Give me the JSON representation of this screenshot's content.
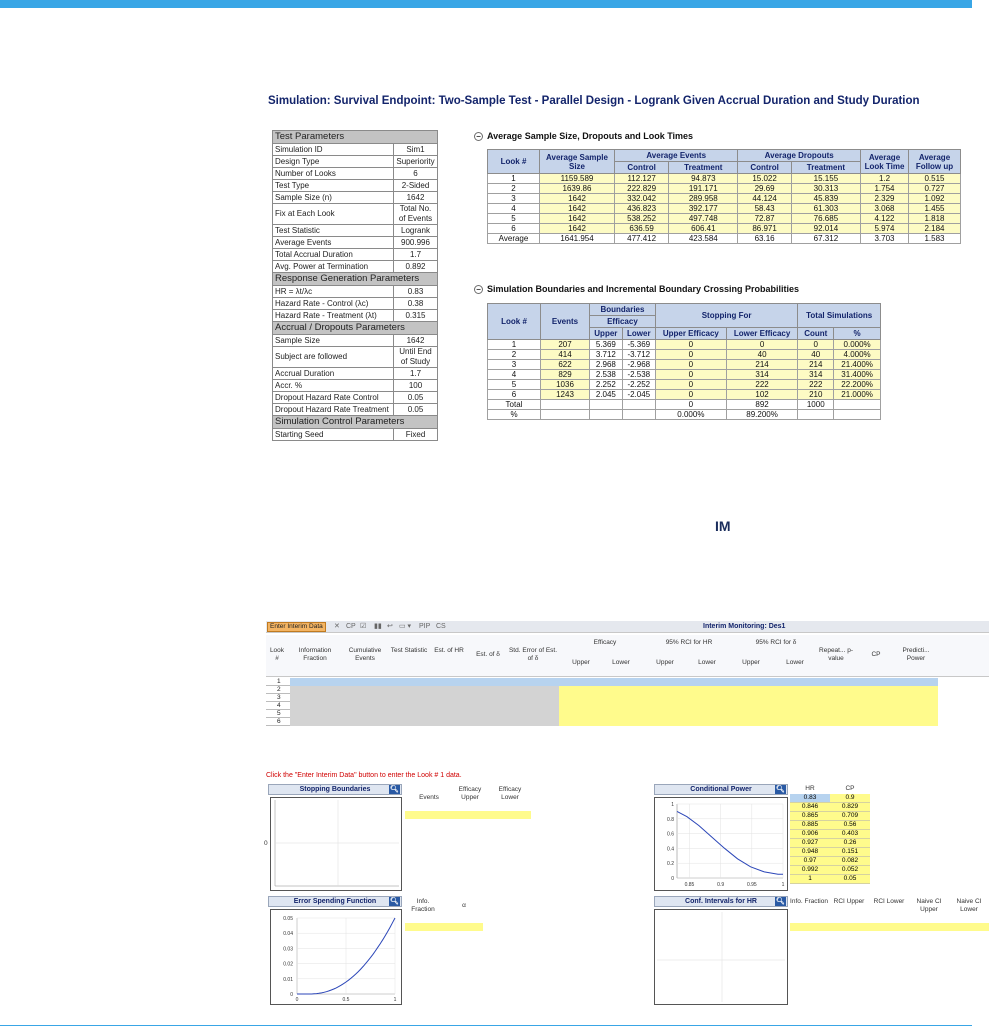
{
  "page_title": "Simulation: Survival Endpoint: Two-Sample Test - Parallel Design - Logrank Given Accrual Duration and Study Duration",
  "test_parameters": {
    "sections": [
      {
        "title": "Test Parameters",
        "rows": [
          [
            "Simulation ID",
            "Sim1"
          ],
          [
            "Design Type",
            "Superiority"
          ],
          [
            "Number of Looks",
            "6"
          ],
          [
            "Test Type",
            "2-Sided"
          ],
          [
            "Sample Size (n)",
            "1642"
          ],
          [
            "Fix at Each Look",
            "Total No. of Events"
          ],
          [
            "Test Statistic",
            "Logrank"
          ],
          [
            "Average Events",
            "900.996"
          ],
          [
            "Total Accrual Duration",
            "1.7"
          ],
          [
            "Avg. Power at Termination",
            "0.892"
          ]
        ]
      },
      {
        "title": "Response Generation Parameters",
        "rows": [
          [
            "HR = λt/λc",
            "0.83"
          ],
          [
            "Hazard Rate - Control (λc)",
            "0.38"
          ],
          [
            "Hazard Rate - Treatment (λt)",
            "0.315"
          ]
        ]
      },
      {
        "title": "Accrual / Dropouts Parameters",
        "rows": [
          [
            "Sample Size",
            "1642"
          ],
          [
            "Subject are followed",
            "Until End of Study"
          ],
          [
            "Accrual Duration",
            "1.7"
          ],
          [
            "Accr. %",
            "100"
          ],
          [
            "Dropout Hazard Rate Control",
            "0.05"
          ],
          [
            "Dropout Hazard Rate Treatment",
            "0.05"
          ]
        ]
      },
      {
        "title": "Simulation Control Parameters",
        "rows": [
          [
            "Starting Seed",
            "Fixed"
          ]
        ]
      }
    ]
  },
  "avg_table": {
    "title": "Average Sample Size, Dropouts and Look Times",
    "headers": {
      "look": "Look #",
      "avg_ss": "Average Sample Size",
      "avg_events": "Average Events",
      "avg_dropouts": "Average Dropouts",
      "control": "Control",
      "treatment": "Treatment",
      "look_time": "Average Look Time",
      "follow_up": "Average Follow up"
    },
    "rows": [
      [
        "1",
        "1159.589",
        "112.127",
        "94.873",
        "15.022",
        "15.155",
        "1.2",
        "0.515"
      ],
      [
        "2",
        "1639.86",
        "222.829",
        "191.171",
        "29.69",
        "30.313",
        "1.754",
        "0.727"
      ],
      [
        "3",
        "1642",
        "332.042",
        "289.958",
        "44.124",
        "45.839",
        "2.329",
        "1.092"
      ],
      [
        "4",
        "1642",
        "436.823",
        "392.177",
        "58.43",
        "61.303",
        "3.068",
        "1.455"
      ],
      [
        "5",
        "1642",
        "538.252",
        "497.748",
        "72.87",
        "76.685",
        "4.122",
        "1.818"
      ],
      [
        "6",
        "1642",
        "636.59",
        "606.41",
        "86.971",
        "92.014",
        "5.974",
        "2.184"
      ],
      [
        "Average",
        "1641.954",
        "477.412",
        "423.584",
        "63.16",
        "67.312",
        "3.703",
        "1.583"
      ]
    ]
  },
  "bound_table": {
    "title": "Simulation Boundaries and Incremental Boundary Crossing Probabilities",
    "headers": {
      "look": "Look #",
      "events": "Events",
      "boundaries": "Boundaries",
      "efficacy": "Efficacy",
      "upper": "Upper",
      "lower": "Lower",
      "stopping": "Stopping For",
      "upper_eff": "Upper Efficacy",
      "lower_eff": "Lower Efficacy",
      "total_sims": "Total Simulations",
      "count": "Count",
      "pct": "%"
    },
    "rows": [
      [
        "1",
        "207",
        "5.369",
        "-5.369",
        "0",
        "0",
        "0",
        "0.000%"
      ],
      [
        "2",
        "414",
        "3.712",
        "-3.712",
        "0",
        "40",
        "40",
        "4.000%"
      ],
      [
        "3",
        "622",
        "2.968",
        "-2.968",
        "0",
        "214",
        "214",
        "21.400%"
      ],
      [
        "4",
        "829",
        "2.538",
        "-2.538",
        "0",
        "314",
        "314",
        "31.400%"
      ],
      [
        "5",
        "1036",
        "2.252",
        "-2.252",
        "0",
        "222",
        "222",
        "22.200%"
      ],
      [
        "6",
        "1243",
        "2.045",
        "-2.045",
        "0",
        "102",
        "210",
        "21.000%"
      ]
    ],
    "total": [
      "Total",
      "",
      "",
      "",
      "0",
      "892",
      "1000",
      ""
    ],
    "pct": [
      "%",
      "",
      "",
      "",
      "0.000%",
      "89.200%",
      "",
      ""
    ]
  },
  "im_label": "IM",
  "im_toolbar": {
    "enter_button": "Enter Interim Data",
    "title": "Interim Monitoring: Des1",
    "tools": [
      "✕",
      "CP",
      "☑",
      "▮▮",
      "↩",
      "▭ ▾",
      "PIP",
      "CS"
    ]
  },
  "im_grid": {
    "headers": [
      "Look #",
      "Information Fraction",
      "Cumulative Events",
      "Test Statistic",
      "Est. of HR",
      "Est. of δ",
      "Std. Error of Est. of δ",
      "Upper",
      "Lower",
      "Upper",
      "Lower",
      "Upper",
      "Lower",
      "Repeat... p-value",
      "CP",
      "Predicti... Power"
    ],
    "groups": [
      "Efficacy",
      "95% RCI for HR",
      "95% RCI for δ"
    ],
    "looks": [
      "1",
      "2",
      "3",
      "4",
      "5",
      "6"
    ]
  },
  "message": "Click the \"Enter Interim Data\" button to enter the Look # 1 data.",
  "panels": {
    "stopping": {
      "title": "Stopping Boundaries",
      "cols": [
        "Events",
        "Efficacy Upper",
        "Efficacy Lower"
      ],
      "axis_label": "0"
    },
    "cp": {
      "title": "Conditional Power",
      "cols": [
        "HR",
        "CP"
      ],
      "rows": [
        [
          "0.83",
          "0.9"
        ],
        [
          "0.846",
          "0.829"
        ],
        [
          "0.865",
          "0.709"
        ],
        [
          "0.885",
          "0.56"
        ],
        [
          "0.906",
          "0.403"
        ],
        [
          "0.927",
          "0.26"
        ],
        [
          "0.948",
          "0.151"
        ],
        [
          "0.97",
          "0.082"
        ],
        [
          "0.992",
          "0.052"
        ],
        [
          "1",
          "0.05"
        ]
      ],
      "y_ticks": [
        "1",
        "0.8",
        "0.6",
        "0.4",
        "0.2",
        "0"
      ],
      "x_ticks": [
        "0.85",
        "0.9",
        "0.95",
        "1"
      ]
    },
    "esf": {
      "title": "Error Spending Function",
      "cols": [
        "Info. Fraction",
        "α"
      ],
      "y_ticks": [
        "0.05",
        "0.04",
        "0.03",
        "0.02",
        "0.01",
        "0"
      ],
      "x_ticks": [
        "0",
        "0.5",
        "1"
      ]
    },
    "ci": {
      "title": "Conf. Intervals for HR",
      "cols": [
        "Info. Fraction",
        "RCI Upper",
        "RCI Lower",
        "Naive CI Upper",
        "Naive CI Lower"
      ]
    }
  }
}
